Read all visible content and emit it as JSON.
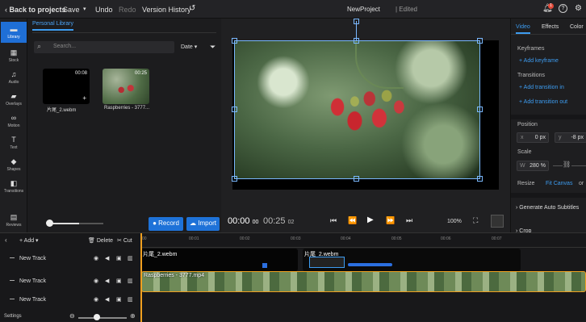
{
  "topbar": {
    "back_label": "Back to projects",
    "save_label": "Save",
    "undo_label": "Undo",
    "redo_label": "Redo",
    "version_history_label": "Version History",
    "project_name": "NewProject",
    "edit_status": "| Edited",
    "notification_count": "1"
  },
  "sidebar": {
    "items": [
      {
        "label": "Library",
        "icon": "folder-icon"
      },
      {
        "label": "Stock",
        "icon": "stock-icon"
      },
      {
        "label": "Audio",
        "icon": "music-icon"
      },
      {
        "label": "Overlays",
        "icon": "overlay-icon"
      },
      {
        "label": "Motion",
        "icon": "motion-icon"
      },
      {
        "label": "Text",
        "icon": "text-icon"
      },
      {
        "label": "Shapes",
        "icon": "shapes-icon"
      },
      {
        "label": "Transitions",
        "icon": "transitions-icon"
      },
      {
        "label": "Reviews",
        "icon": "reviews-icon"
      }
    ]
  },
  "library": {
    "tab_label": "Personal Library",
    "search_placeholder": "Search...",
    "sort_label": "Date",
    "media": [
      {
        "name": "片尾_2.webm",
        "duration": "00:08"
      },
      {
        "name": "Raspberries - 3777...",
        "duration": "00:25"
      }
    ],
    "record_label": "Record",
    "import_label": "Import"
  },
  "player": {
    "current_time": "00:00",
    "current_frames": "00",
    "total_time": "00:25",
    "total_frames": "02",
    "zoom": "100%"
  },
  "properties": {
    "tabs": [
      "Video",
      "Effects",
      "Color"
    ],
    "keyframes_title": "Keyframes",
    "add_keyframe": "+ Add keyframe",
    "transitions_title": "Transitions",
    "add_transition_in": "+ Add transition in",
    "add_transition_out": "+ Add transition out",
    "position_title": "Position",
    "pos_x_label": "x",
    "pos_x": "0 px",
    "pos_y_label": "y",
    "pos_y": "-8 px",
    "scale_title": "Scale",
    "scale_w_label": "W",
    "scale_w": "280 %",
    "resize_label": "Resize",
    "fit_canvas": "Fit Canvas",
    "resize_or": "or",
    "generate_subtitles": "Generate Auto Subtitles",
    "crop_label": "Crop"
  },
  "timeline": {
    "add_label": "+ Add",
    "delete_label": "Delete",
    "cut_label": "Cut",
    "ruler": [
      "00",
      "00:01",
      "00:02",
      "00:03",
      "00:04",
      "00:05",
      "00:06",
      "00:07"
    ],
    "tracks": [
      {
        "name": "New Track"
      },
      {
        "name": "New Track"
      },
      {
        "name": "New Track"
      }
    ],
    "clips": {
      "c1": "片尾_2.webm",
      "c2": "片尾_2.webm",
      "c3": "Raspberries - 3777.mp4"
    },
    "settings_label": "Settings"
  },
  "colors": {
    "accent": "#1e72d8",
    "playhead": "#f0a020"
  }
}
